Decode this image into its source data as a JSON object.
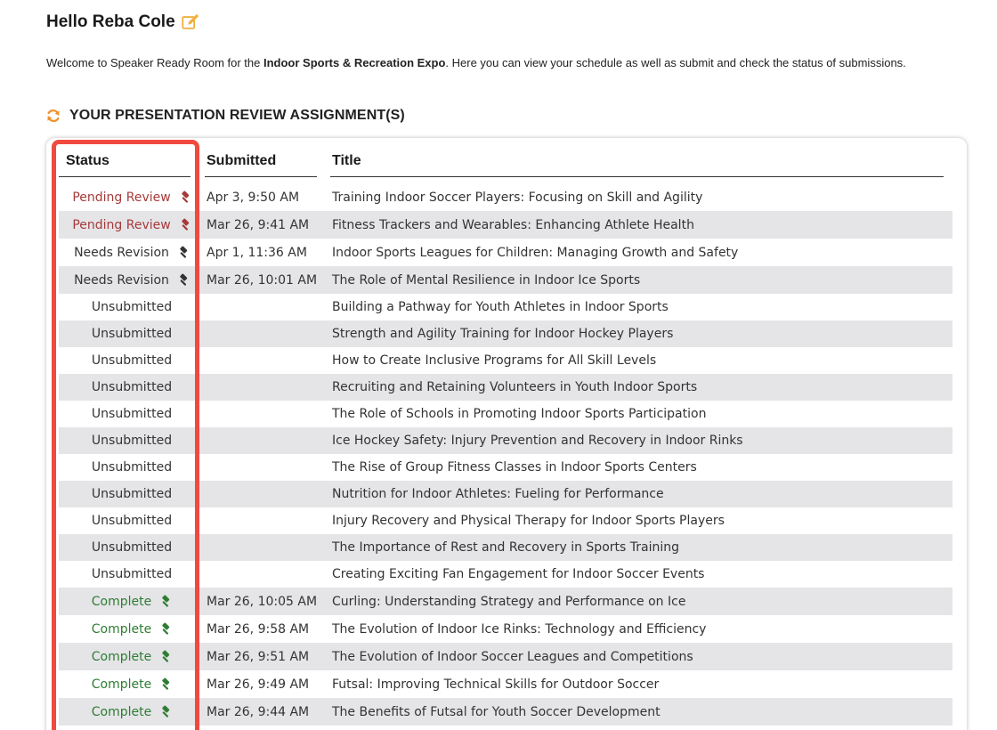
{
  "greeting": {
    "text": "Hello Reba Cole"
  },
  "welcome": {
    "prefix": "Welcome to Speaker Ready Room for the ",
    "event": "Indoor Sports & Recreation Expo",
    "suffix": ". Here you can view your schedule as well as submit and check the status of submissions."
  },
  "section": {
    "title": "YOUR PRESENTATION REVIEW ASSIGNMENT(S)"
  },
  "table": {
    "headers": {
      "status": "Status",
      "submitted": "Submitted",
      "title": "Title"
    },
    "rows": [
      {
        "status": "Pending Review",
        "kind": "pending",
        "submitted": "Apr 3, 9:50 AM",
        "title": "Training Indoor Soccer Players: Focusing on Skill and Agility"
      },
      {
        "status": "Pending Review",
        "kind": "pending",
        "submitted": "Mar 26, 9:41 AM",
        "title": "Fitness Trackers and Wearables: Enhancing Athlete Health"
      },
      {
        "status": "Needs Revision",
        "kind": "revision",
        "submitted": "Apr 1, 11:36 AM",
        "title": "Indoor Sports Leagues for Children: Managing Growth and Safety"
      },
      {
        "status": "Needs Revision",
        "kind": "revision",
        "submitted": "Mar 26, 10:01 AM",
        "title": "The Role of Mental Resilience in Indoor Ice Sports"
      },
      {
        "status": "Unsubmitted",
        "kind": "unsub",
        "submitted": "",
        "title": "Building a Pathway for Youth Athletes in Indoor Sports"
      },
      {
        "status": "Unsubmitted",
        "kind": "unsub",
        "submitted": "",
        "title": "Strength and Agility Training for Indoor Hockey Players"
      },
      {
        "status": "Unsubmitted",
        "kind": "unsub",
        "submitted": "",
        "title": "How to Create Inclusive Programs for All Skill Levels"
      },
      {
        "status": "Unsubmitted",
        "kind": "unsub",
        "submitted": "",
        "title": "Recruiting and Retaining Volunteers in Youth Indoor Sports"
      },
      {
        "status": "Unsubmitted",
        "kind": "unsub",
        "submitted": "",
        "title": "The Role of Schools in Promoting Indoor Sports Participation"
      },
      {
        "status": "Unsubmitted",
        "kind": "unsub",
        "submitted": "",
        "title": "Ice Hockey Safety: Injury Prevention and Recovery in Indoor Rinks"
      },
      {
        "status": "Unsubmitted",
        "kind": "unsub",
        "submitted": "",
        "title": "The Rise of Group Fitness Classes in Indoor Sports Centers"
      },
      {
        "status": "Unsubmitted",
        "kind": "unsub",
        "submitted": "",
        "title": "Nutrition for Indoor Athletes: Fueling for Performance"
      },
      {
        "status": "Unsubmitted",
        "kind": "unsub",
        "submitted": "",
        "title": "Injury Recovery and Physical Therapy for Indoor Sports Players"
      },
      {
        "status": "Unsubmitted",
        "kind": "unsub",
        "submitted": "",
        "title": "The Importance of Rest and Recovery in Sports Training"
      },
      {
        "status": "Unsubmitted",
        "kind": "unsub",
        "submitted": "",
        "title": "Creating Exciting Fan Engagement for Indoor Soccer Events"
      },
      {
        "status": "Complete",
        "kind": "complete",
        "submitted": "Mar 26, 10:05 AM",
        "title": "Curling: Understanding Strategy and Performance on Ice"
      },
      {
        "status": "Complete",
        "kind": "complete",
        "submitted": "Mar 26, 9:58 AM",
        "title": "The Evolution of Indoor Ice Rinks: Technology and Efficiency"
      },
      {
        "status": "Complete",
        "kind": "complete",
        "submitted": "Mar 26, 9:51 AM",
        "title": "The Evolution of Indoor Soccer Leagues and Competitions"
      },
      {
        "status": "Complete",
        "kind": "complete",
        "submitted": "Mar 26, 9:49 AM",
        "title": "Futsal: Improving Technical Skills for Outdoor Soccer"
      },
      {
        "status": "Complete",
        "kind": "complete",
        "submitted": "Mar 26, 9:44 AM",
        "title": "The Benefits of Futsal for Youth Soccer Development"
      }
    ]
  },
  "colors": {
    "pending": "#a53a3a",
    "revision": "#333333",
    "complete": "#2e7d32",
    "highlight": "#f04a40",
    "edit_icon": "#f0b040",
    "refresh_icon": "#f0902a"
  },
  "icons": {
    "edit": "edit-icon",
    "refresh": "refresh-icon",
    "gavel": "gavel-icon"
  }
}
